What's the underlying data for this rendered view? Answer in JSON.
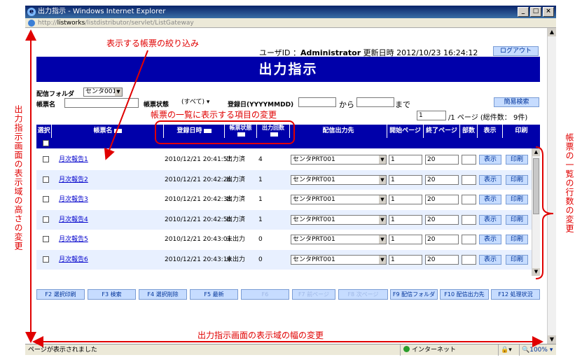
{
  "window": {
    "title": "出力指示 - Windows Internet Explorer",
    "address_prefix": "http://",
    "address_host": "listworks",
    "address_path": "/listdistributor/servlet/ListGateway"
  },
  "header": {
    "user_label": "ユーザID ：",
    "user_value": "Administrator",
    "updated_label": "更新日時",
    "updated_value": "2012/10/23 16:24:12",
    "logout_label": "ログアウト",
    "page_title": "出力指示"
  },
  "filters": {
    "folder_label": "配信フォルダ",
    "folder_value": "センタ001",
    "report_label": "帳票名",
    "status_label": "帳票状態",
    "status_value": "(すべて)",
    "date_label": "登録日(YYYYMMDD)",
    "from_label": "から",
    "to_label": "まで",
    "simple_search_label": "簡易検索",
    "page_value": "1",
    "page_of": "/1",
    "page_label": "ページ (総件数：",
    "total_count": "9件)"
  },
  "table": {
    "headers": {
      "select": "選択",
      "report": "帳票名",
      "date": "登録日時",
      "status": "帳票状態",
      "count": "出力回数",
      "dest": "配信出力先",
      "start": "開始ページ",
      "end": "終了ページ",
      "copies": "部数",
      "view": "表示",
      "print": "印刷"
    },
    "rows": [
      {
        "name": "月次報告1",
        "date": "2010/12/21 20:41:57",
        "status": "出力済",
        "count": "4",
        "dest": "センタPRT001",
        "start": "1",
        "end": "20",
        "view": "表示",
        "print": "印刷"
      },
      {
        "name": "月次報告2",
        "date": "2010/12/21 20:42:26",
        "status": "出力済",
        "count": "1",
        "dest": "センタPRT001",
        "start": "1",
        "end": "20",
        "view": "表示",
        "print": "印刷"
      },
      {
        "name": "月次報告3",
        "date": "2010/12/21 20:42:38",
        "status": "出力済",
        "count": "1",
        "dest": "センタPRT001",
        "start": "1",
        "end": "20",
        "view": "表示",
        "print": "印刷"
      },
      {
        "name": "月次報告4",
        "date": "2010/12/21 20:42:50",
        "status": "出力済",
        "count": "1",
        "dest": "センタPRT001",
        "start": "1",
        "end": "20",
        "view": "表示",
        "print": "印刷"
      },
      {
        "name": "月次報告5",
        "date": "2010/12/21 20:43:01",
        "status": "未出力",
        "count": "0",
        "dest": "センタPRT001",
        "start": "1",
        "end": "20",
        "view": "表示",
        "print": "印刷"
      },
      {
        "name": "月次報告6",
        "date": "2010/12/21 20:43:10",
        "status": "未出力",
        "count": "0",
        "dest": "センタPRT001",
        "start": "1",
        "end": "20",
        "view": "表示",
        "print": "印刷"
      }
    ]
  },
  "fkeys": [
    "F2 選択印刷",
    "F3 検索",
    "F4 選択削除",
    "F5 最新",
    "F6",
    "F7 前ページ",
    "F8 次ページ",
    "F9 配信フォルダ",
    "F10 配信出力先",
    "F12 処理状況"
  ],
  "annotations": {
    "filter_note": "表示する帳票の絞り込み",
    "columns_note": "帳票の一覧に表示する項目の変更",
    "height_note": "出力指示画面の表示域の高さの変更",
    "width_note": "出力指示画面の表示域の幅の変更",
    "rows_note": "帳票の一覧の行数の変更"
  },
  "statusbar": {
    "message": "ページが表示されました",
    "zone": "インターネット",
    "zoom": "100%"
  },
  "colors": {
    "header_blue": "#0000aa",
    "annotation_red": "#e00000",
    "row_alt": "#e8f0ff"
  }
}
